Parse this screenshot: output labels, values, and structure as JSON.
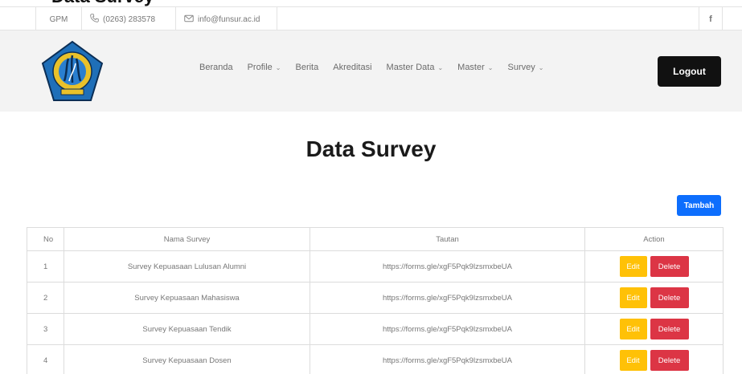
{
  "window": {
    "clipped_title": "Data Survey"
  },
  "topbar": {
    "label": "GPM",
    "phone": "(0263) 283578",
    "email": "info@funsur.ac.id",
    "social_icon": "facebook-icon"
  },
  "header": {
    "logo": "university-seal",
    "menu": [
      {
        "label": "Beranda",
        "dropdown": false
      },
      {
        "label": "Profile",
        "dropdown": true
      },
      {
        "label": "Berita",
        "dropdown": false
      },
      {
        "label": "Akreditasi",
        "dropdown": false
      },
      {
        "label": "Master Data",
        "dropdown": true
      },
      {
        "label": "Master",
        "dropdown": true
      },
      {
        "label": "Survey",
        "dropdown": true
      }
    ],
    "logout_label": "Logout"
  },
  "main": {
    "title": "Data Survey",
    "add_label": "Tambah",
    "table": {
      "columns": [
        "No",
        "Nama Survey",
        "Tautan",
        "Action"
      ],
      "rows": [
        {
          "no": "1",
          "name": "Survey Kepuasaan Lulusan Alumni",
          "link": "https://forms.gle/xgF5Pqk9lzsmxbeUA"
        },
        {
          "no": "2",
          "name": "Survey Kepuasaan Mahasiswa",
          "link": "https://forms.gle/xgF5Pqk9lzsmxbeUA"
        },
        {
          "no": "3",
          "name": "Survey Kepuasaan Tendik",
          "link": "https://forms.gle/xgF5Pqk9lzsmxbeUA"
        },
        {
          "no": "4",
          "name": "Survey Kepuasaan Dosen",
          "link": "https://forms.gle/xgF5Pqk9lzsmxbeUA"
        }
      ],
      "edit_label": "Edit",
      "delete_label": "Delete"
    }
  },
  "colors": {
    "primary": "#0d6efd",
    "warning": "#ffc107",
    "danger": "#dc3545",
    "dark": "#111111"
  }
}
